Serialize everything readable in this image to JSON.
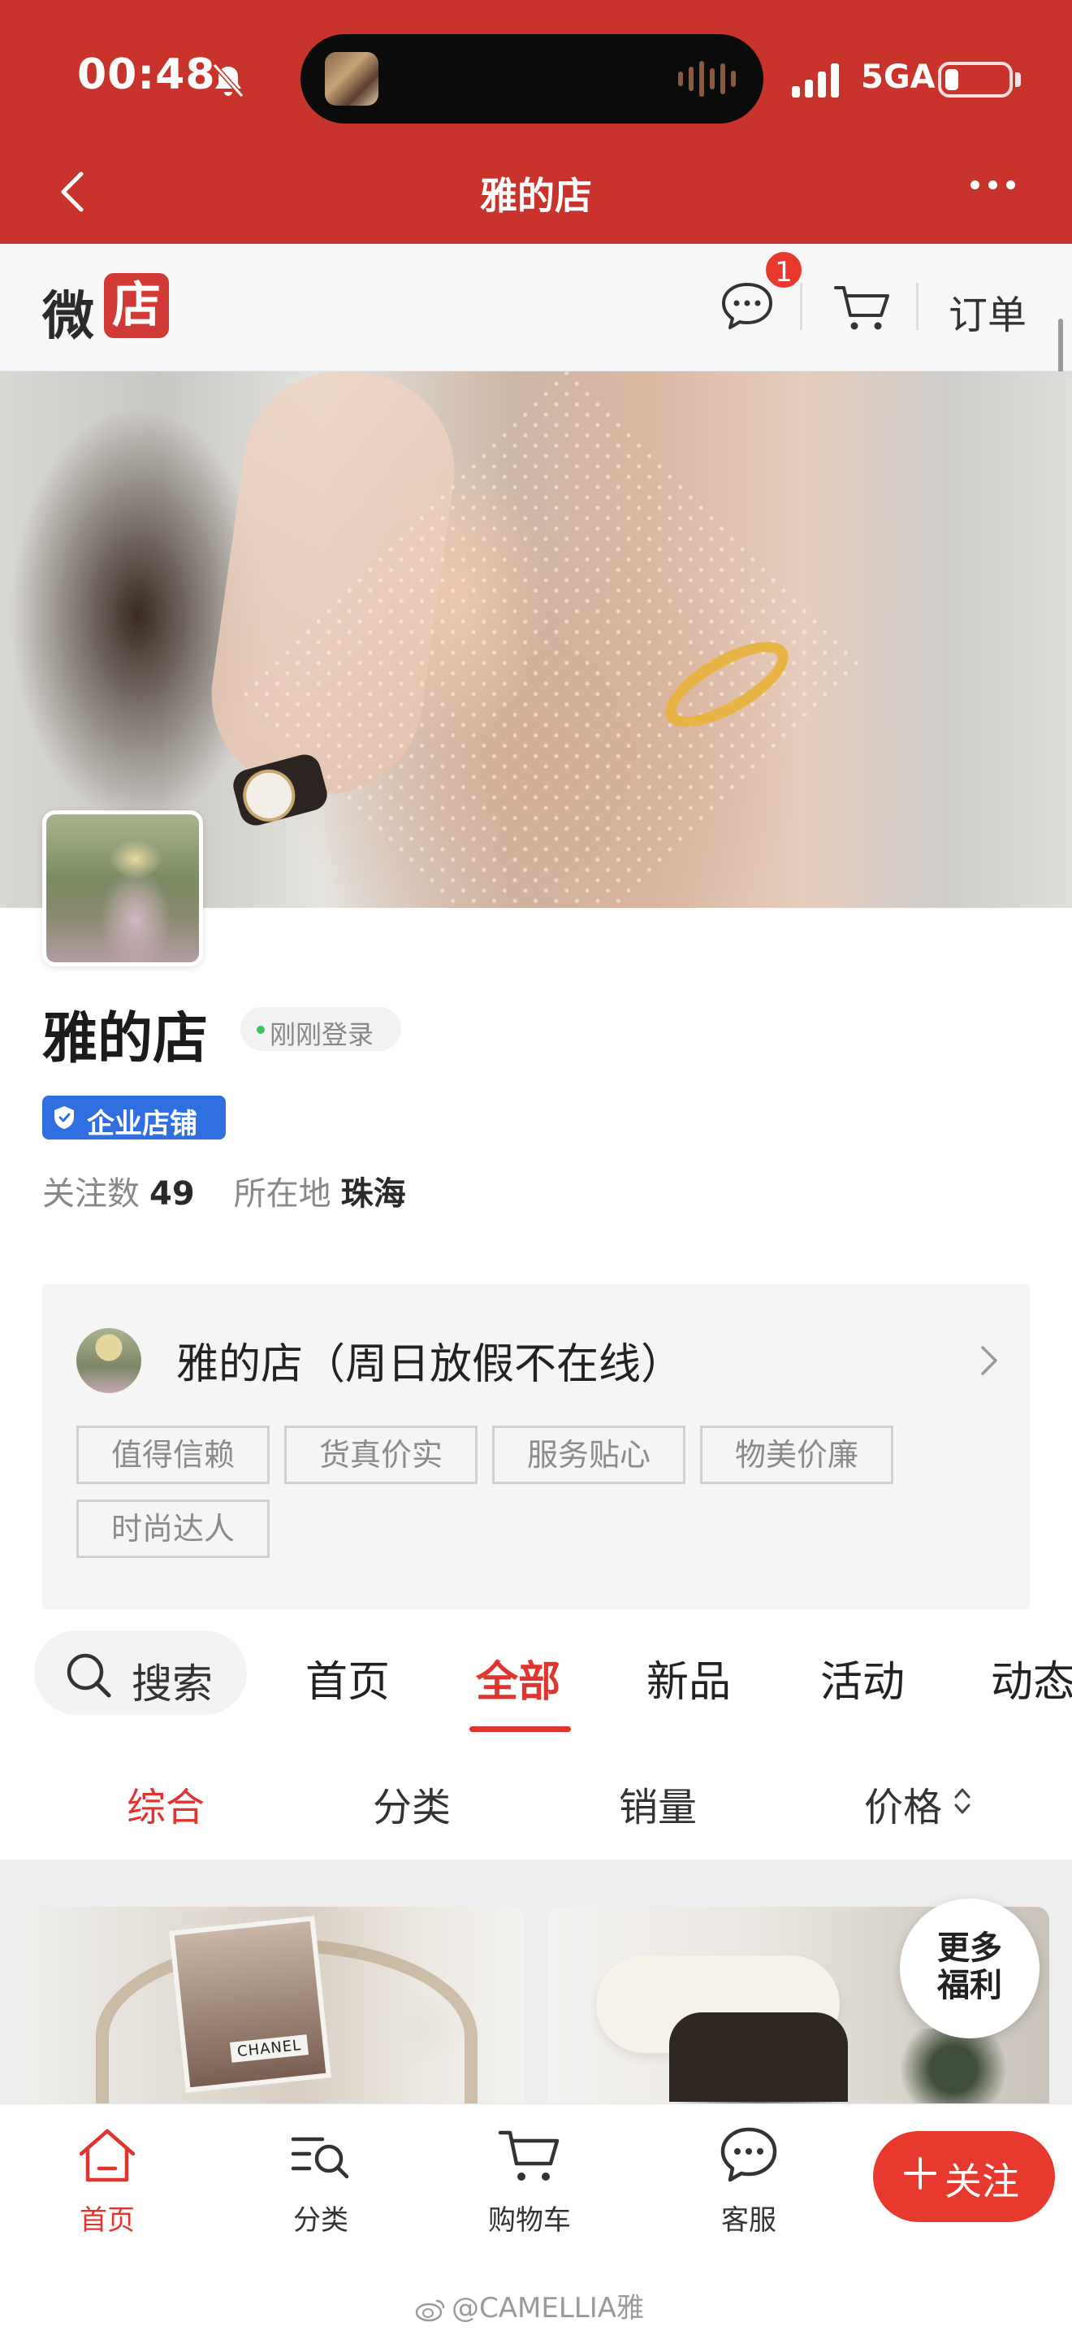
{
  "status_bar": {
    "time": "00:48",
    "network": "5GA"
  },
  "nav": {
    "title": "雅的店"
  },
  "top_bar": {
    "logo_left": "微",
    "logo_right": "店",
    "message_badge": "1",
    "orders_label": "订单"
  },
  "profile": {
    "shop_name": "雅的店",
    "online_status": "刚刚登录",
    "enterprise_badge": "企业店铺",
    "followers_label": "关注数",
    "followers_count": "49",
    "location_label": "所在地",
    "location_value": "珠海"
  },
  "shop_card": {
    "title": "雅的店（周日放假不在线）",
    "tags": [
      "值得信赖",
      "货真价实",
      "服务贴心",
      "物美价廉",
      "时尚达人"
    ]
  },
  "tabs": {
    "search_label": "搜索",
    "items": [
      "首页",
      "全部",
      "新品",
      "活动",
      "动态"
    ],
    "active": "全部"
  },
  "sort": {
    "items": [
      "综合",
      "分类",
      "销量",
      "价格"
    ],
    "active": "综合"
  },
  "products": {
    "card1_brand_text": "CHANEL"
  },
  "more_benefits": {
    "line1": "更多",
    "line2": "福利"
  },
  "bottom_nav": {
    "items": [
      "首页",
      "分类",
      "购物车",
      "客服"
    ],
    "follow_label": "关注"
  },
  "watermark": "@CAMELLIA雅",
  "colors": {
    "header_red": "#c8332b",
    "accent_red": "#e0352f",
    "enterprise_blue": "#2f6fe0"
  }
}
